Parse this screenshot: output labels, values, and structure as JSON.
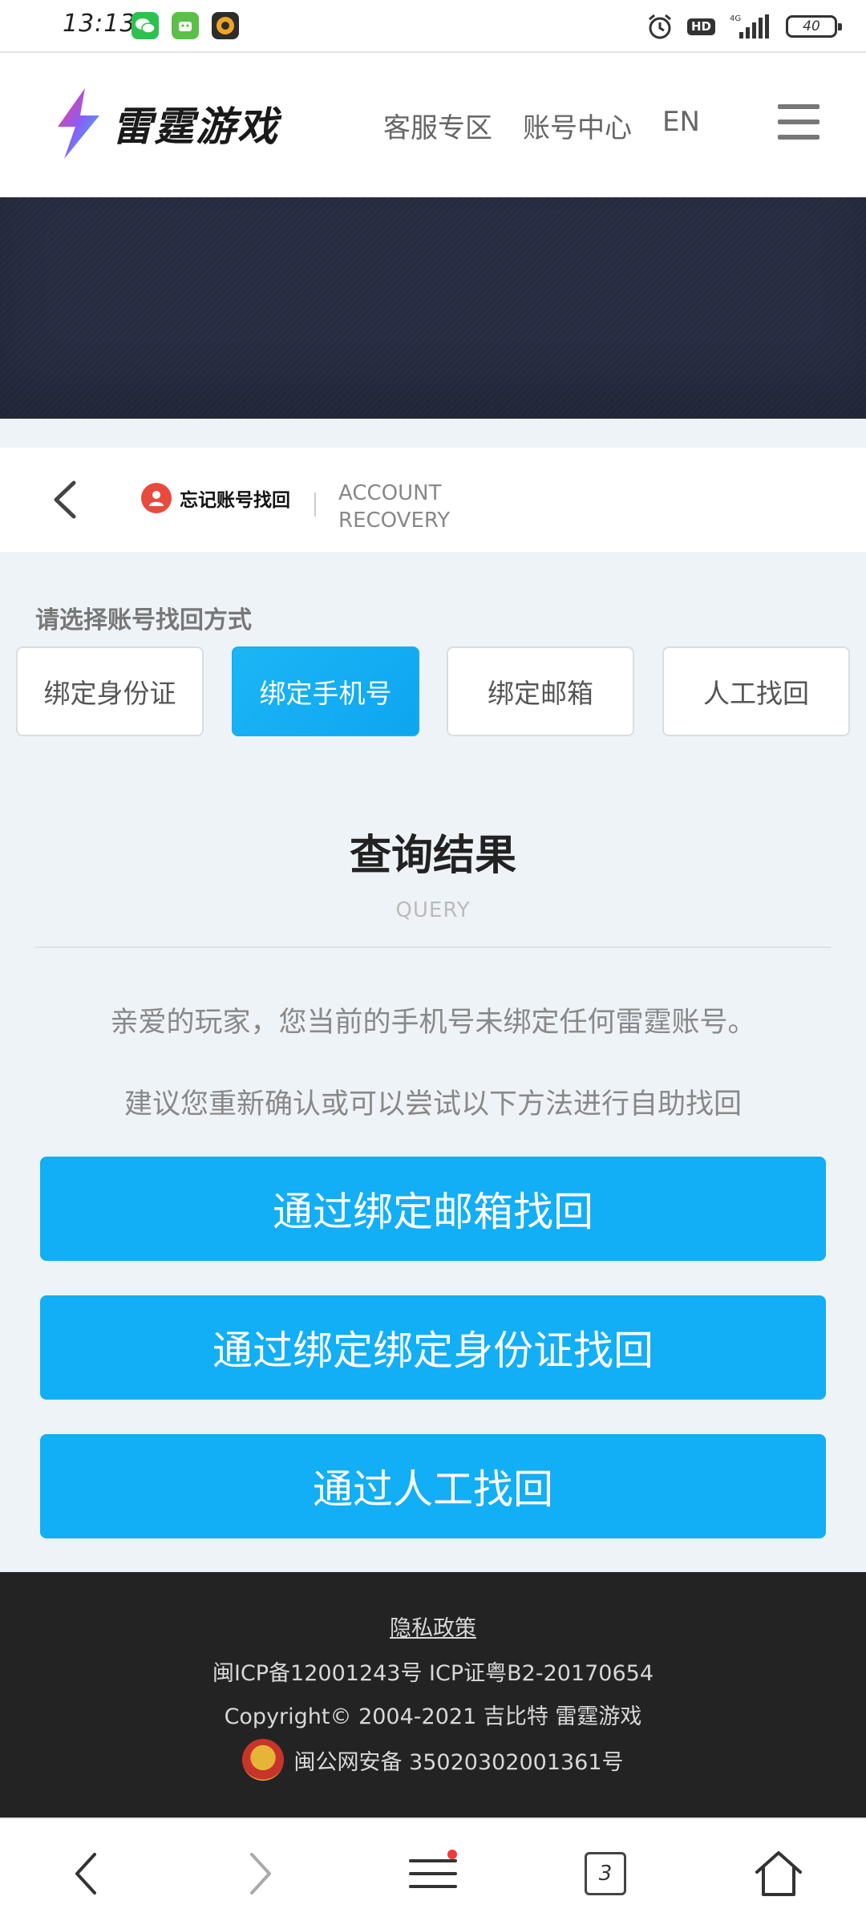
{
  "status_bar": {
    "time": "13:13",
    "hd": "HD",
    "network": "4G",
    "battery": "40"
  },
  "header": {
    "logo_text": "雷霆游戏",
    "nav": [
      "客服专区",
      "账号中心",
      "EN"
    ]
  },
  "titlebar": {
    "title_cn": "忘记账号找回",
    "title_en_line1": "ACCOUNT",
    "title_en_line2": "RECOVERY"
  },
  "methods": {
    "label": "请选择账号找回方式",
    "tabs": [
      "绑定身份证",
      "绑定手机号",
      "绑定邮箱",
      "人工找回"
    ],
    "active_index": 1
  },
  "result": {
    "title": "查询结果",
    "subtitle": "QUERY",
    "message1": "亲爱的玩家，您当前的手机号未绑定任何雷霆账号。",
    "message2": "建议您重新确认或可以尝试以下方法进行自助找回",
    "buttons": [
      "通过绑定邮箱找回",
      "通过绑定绑定身份证找回",
      "通过人工找回"
    ]
  },
  "footer": {
    "privacy": "隐私政策",
    "icp": "闽ICP备12001243号   ICP证粤B2-20170654",
    "copyright": "Copyright© 2004-2021  吉比特  雷霆游戏",
    "police": "闽公网安备 35020302001361号"
  },
  "bottom_nav": {
    "tab_count": "3"
  },
  "colors": {
    "accent": "#12aef6",
    "footer_bg": "#232323",
    "banner_bg": "#2a2f45"
  }
}
